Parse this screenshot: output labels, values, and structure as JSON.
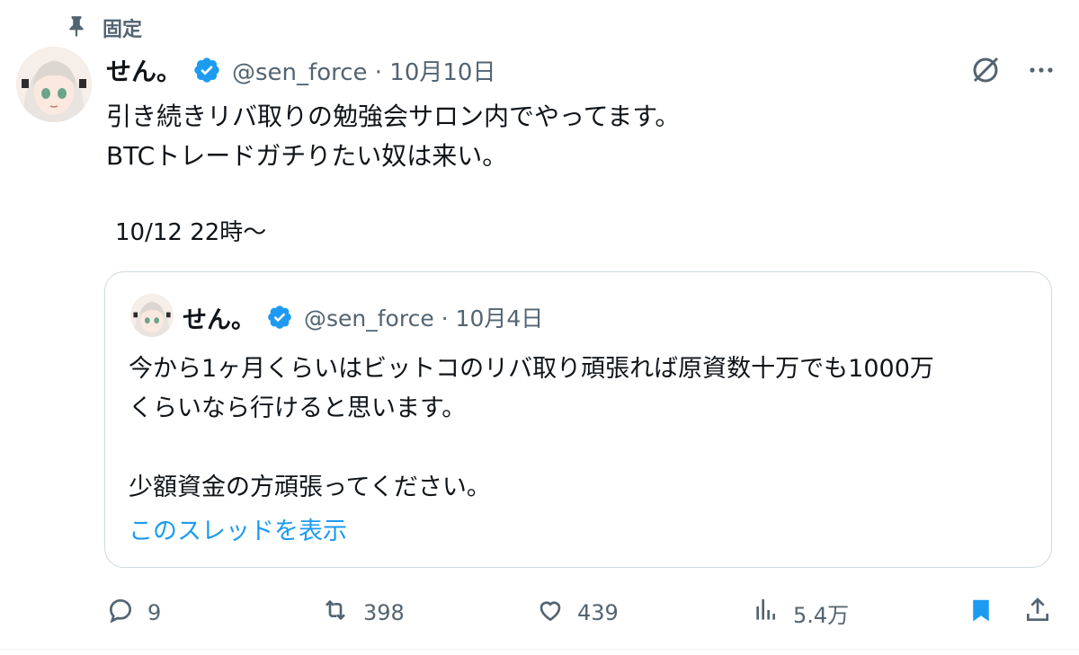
{
  "pinned": {
    "label": "固定"
  },
  "post": {
    "author_name": "せん。",
    "handle_date": "@sen_force · 10月10日",
    "text_lines": [
      "引き続きリバ取りの勉強会サロン内でやってます。",
      "BTCトレードガチりたい奴は来い。"
    ],
    "event_time": "10/12 22時〜"
  },
  "quote": {
    "author_name": "せん。",
    "handle_date": "@sen_force · 10月4日",
    "text_lines": [
      "今から1ヶ月くらいはビットコのリバ取り頑張れば原資数十万でも1000万",
      "くらいなら行けると思います。",
      "",
      "少額資金の方頑張ってください。"
    ],
    "show_thread": "このスレッドを表示"
  },
  "actions": {
    "replies": "9",
    "reposts": "398",
    "likes": "439",
    "views": "5.4万"
  },
  "colors": {
    "accent": "#1d9bf0",
    "secondary_text": "#536471",
    "border": "#cfd9de"
  }
}
